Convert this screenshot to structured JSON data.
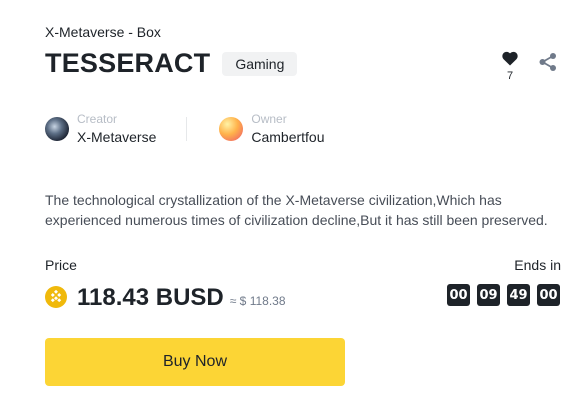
{
  "collection": "X-Metaverse - Box",
  "title": "TESSERACT",
  "tag": "Gaming",
  "likes": {
    "count": "7",
    "icon": "heart-icon"
  },
  "share": {
    "icon": "share-icon"
  },
  "creator": {
    "role": "Creator",
    "name": "X-Metaverse"
  },
  "owner": {
    "role": "Owner",
    "name": "Cambertfou"
  },
  "description": "The technological crystallization of the X-Metaverse civilization,Which has experienced numerous times of civilization decline,But it has still been preserved.",
  "price": {
    "label": "Price",
    "amount": "118.43 BUSD",
    "approx": "≈ $ 118.38",
    "coin_icon": "busd-coin-icon"
  },
  "countdown": {
    "label": "Ends in",
    "values": [
      "00",
      "09",
      "49",
      "00"
    ]
  },
  "buy_button": "Buy Now",
  "colors": {
    "accent": "#fcd535",
    "coin": "#f0b90b",
    "text": "#1e2329",
    "muted": "#b7bdc6"
  }
}
